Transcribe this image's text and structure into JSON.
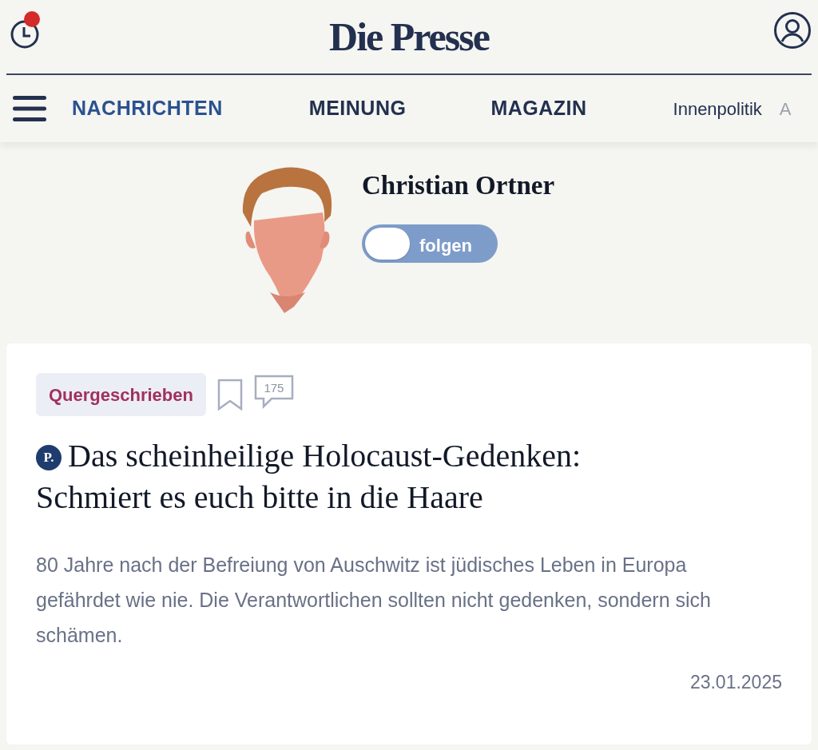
{
  "header": {
    "logo": "Die Presse",
    "history_notification": true
  },
  "nav": [
    {
      "label": "NACHRICHTEN",
      "kind": "section",
      "selected": true
    },
    {
      "label": "MEINUNG",
      "kind": "section",
      "selected": false
    },
    {
      "label": "MAGAZIN",
      "kind": "section",
      "selected": false
    },
    {
      "label": "Innenpolitik",
      "kind": "topic",
      "selected": false
    },
    {
      "label": "A",
      "kind": "faded",
      "selected": false
    }
  ],
  "author": {
    "name": "Christian Ortner",
    "follow": {
      "label": "folgen",
      "on": false
    }
  },
  "article": {
    "tag": "Quergeschrieben",
    "comments": "175",
    "premium_badge": "P.",
    "headline": "Das scheinheilige Holocaust-Gedenken: Schmiert es euch bitte in die Haare",
    "lead": "80 Jahre nach der Befreiung von Auschwitz ist jüdisches Leben in Europa gefährdet wie nie. Die Verantwortlichen sollten nicht gedenken, sondern sich schämen.",
    "date": "23.01.2025"
  }
}
